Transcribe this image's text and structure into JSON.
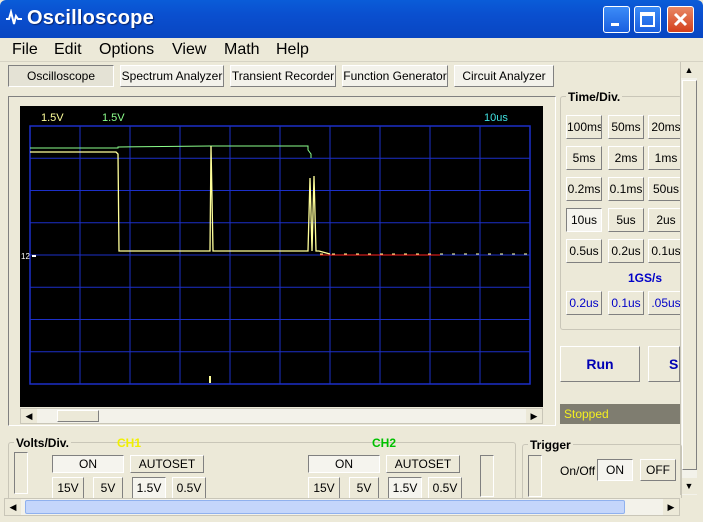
{
  "window": {
    "title": "Oscilloscope"
  },
  "menu": [
    "File",
    "Edit",
    "Options",
    "View",
    "Math",
    "Help"
  ],
  "modes": [
    "Oscilloscope",
    "Spectrum Analyzer",
    "Transient Recorder",
    "Function Generator",
    "Circuit Analyzer"
  ],
  "scope": {
    "ch1_volts_readout": "1.5V",
    "ch2_volts_readout": "1.5V",
    "time_readout": "10us",
    "ground_marker": "12",
    "colors": {
      "background": "#000000",
      "grid": "#1c2fc8",
      "ch1": "#ffff9a",
      "ch2": "#8cff8c",
      "ch2_flat": "#ff2020"
    }
  },
  "time_div": {
    "label": "Time/Div.",
    "buttons": [
      [
        "100ms",
        "50ms",
        "20ms"
      ],
      [
        "5ms",
        "2ms",
        "1ms"
      ],
      [
        "0.2ms",
        "0.1ms",
        "50us"
      ],
      [
        "10us",
        "5us",
        "2us"
      ],
      [
        "0.5us",
        "0.2us",
        "0.1us"
      ]
    ],
    "selected": "10us",
    "sample_rate": "1GS/s",
    "fast_buttons": [
      "0.2us",
      "0.1us",
      ".05us"
    ]
  },
  "controls": {
    "run_label": "Run",
    "stop_label": "S",
    "status": "Stopped"
  },
  "volts_div": {
    "label": "Volts/Div.",
    "ch1": {
      "name": "CH1",
      "on_label": "ON",
      "autoset_label": "AUTOSET",
      "scales": [
        "15V",
        "5V",
        "1.5V",
        "0.5V"
      ],
      "selected": "1.5V"
    },
    "ch2": {
      "name": "CH2",
      "on_label": "ON",
      "autoset_label": "AUTOSET",
      "scales": [
        "15V",
        "5V",
        "1.5V",
        "0.5V"
      ],
      "selected": "1.5V"
    }
  },
  "trigger": {
    "label": "Trigger",
    "onoff_label": "On/Off",
    "on_label": "ON",
    "off_label": "OFF"
  }
}
